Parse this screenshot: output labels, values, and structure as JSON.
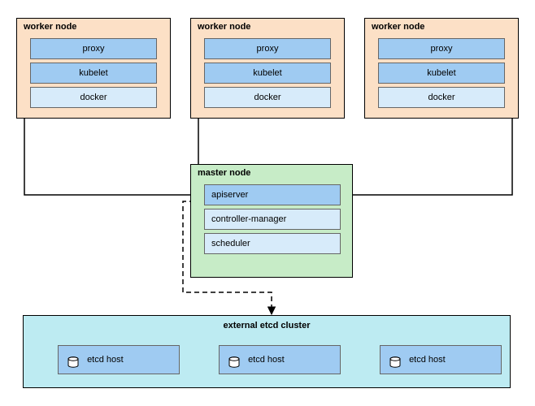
{
  "workers": [
    {
      "title": "worker node",
      "components": [
        "proxy",
        "kubelet",
        "docker"
      ]
    },
    {
      "title": "worker node",
      "components": [
        "proxy",
        "kubelet",
        "docker"
      ]
    },
    {
      "title": "worker node",
      "components": [
        "proxy",
        "kubelet",
        "docker"
      ]
    }
  ],
  "master": {
    "title": "master node",
    "components": [
      "apiserver",
      "controller-manager",
      "scheduler"
    ]
  },
  "etcd": {
    "title": "external etcd cluster",
    "hosts": [
      "etcd host",
      "etcd host",
      "etcd host"
    ]
  },
  "connections": {
    "workers_to_master": "solid-arrow",
    "master_to_etcd": "dashed-bidirectional"
  }
}
